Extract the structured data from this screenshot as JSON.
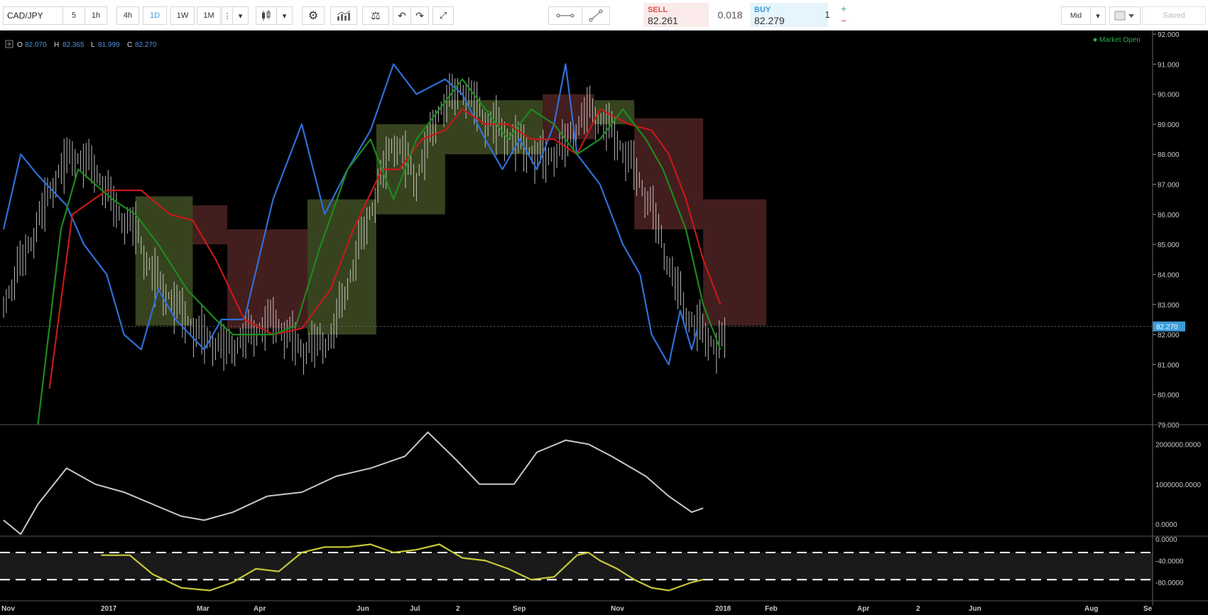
{
  "toolbar": {
    "symbol": "CAD/JPY",
    "timeframes": [
      "5",
      "1h",
      "4h",
      "1D",
      "1W",
      "1M"
    ],
    "active_timeframe": "1D",
    "sell_label": "SELL",
    "sell_price": "82.261",
    "spread": "0.018",
    "buy_label": "BUY",
    "buy_price": "82.279",
    "quantity": "1",
    "plus": "+",
    "minus": "−",
    "price_mode": "Mid",
    "saved_label": "Saved",
    "icons": [
      "more-icon",
      "dropdown-icon",
      "candlestick-icon",
      "settings-icon",
      "indicators-icon",
      "balance-icon",
      "undo-icon",
      "redo-icon",
      "fullscreen-icon",
      "horizontal-line-icon",
      "trend-line-icon",
      "color-swatch-icon"
    ]
  },
  "ohlc": {
    "open_label": "O",
    "open": "82.070",
    "high_label": "H",
    "high": "82.365",
    "low_label": "L",
    "low": "81.999",
    "close_label": "C",
    "close": "82.270"
  },
  "market_status": "Market Open",
  "colors": {
    "background": "#000000",
    "price_bars": "#d9d9d9",
    "blue_line": "#2f6fd6",
    "red_line": "#c81818",
    "green_line": "#1d8a1d",
    "cloud_bull": "#4a5a2a",
    "cloud_bear": "#5a2828",
    "volume_line": "#c8c8c8",
    "oscillator_line": "#c8c83a",
    "price_tag": "#3a9ad9"
  },
  "chart_data": [
    {
      "type": "line",
      "symbol": "CAD/JPY",
      "ylim": [
        79.0,
        92.0
      ],
      "y_ticks": [
        "92.000",
        "91.000",
        "90.000",
        "89.000",
        "88.000",
        "87.000",
        "86.000",
        "85.000",
        "84.000",
        "83.000",
        "82.000",
        "81.000",
        "80.000",
        "79.000"
      ],
      "current_price": "82.270",
      "x_ticks": [
        "Nov",
        "2017",
        "Mar",
        "Apr",
        "Jun",
        "Jul",
        "2",
        "Sep",
        "Nov",
        "2018",
        "Feb",
        "Apr",
        "2",
        "Jun",
        "Aug",
        "Se"
      ],
      "price_approx": [
        [
          0,
          83
        ],
        [
          25,
          85.2
        ],
        [
          45,
          87.2
        ],
        [
          60,
          88.0
        ],
        [
          80,
          87.5
        ],
        [
          100,
          86.0
        ],
        [
          115,
          85.5
        ],
        [
          130,
          84.0
        ],
        [
          150,
          83.0
        ],
        [
          170,
          82.0
        ],
        [
          195,
          81.5
        ],
        [
          215,
          82.0
        ],
        [
          235,
          82.5
        ],
        [
          260,
          81.5
        ],
        [
          285,
          81.8
        ],
        [
          315,
          85.5
        ],
        [
          340,
          88.5
        ],
        [
          360,
          87.2
        ],
        [
          380,
          89.5
        ],
        [
          400,
          90.2
        ],
        [
          420,
          89.2
        ],
        [
          445,
          88.5
        ],
        [
          470,
          87.8
        ],
        [
          490,
          88.3
        ],
        [
          510,
          89.5
        ],
        [
          530,
          88.8
        ],
        [
          550,
          87.5
        ],
        [
          565,
          86.2
        ],
        [
          580,
          84.3
        ],
        [
          595,
          82.7
        ],
        [
          610,
          82.0
        ],
        [
          622,
          81.6
        ],
        [
          630,
          81.9
        ]
      ],
      "series": [
        {
          "name": "",
          "role": "lagging span (blue)",
          "points": [
            [
              0,
              85.5
            ],
            [
              15,
              88.0
            ],
            [
              30,
              87.3
            ],
            [
              55,
              86.3
            ],
            [
              70,
              85.0
            ],
            [
              90,
              84.0
            ],
            [
              105,
              82.0
            ],
            [
              120,
              81.5
            ],
            [
              135,
              83.5
            ],
            [
              150,
              82.5
            ],
            [
              175,
              81.5
            ],
            [
              190,
              82.5
            ],
            [
              210,
              82.5
            ],
            [
              235,
              86.5
            ],
            [
              260,
              89.0
            ],
            [
              280,
              86.0
            ],
            [
              300,
              87.5
            ],
            [
              320,
              88.8
            ],
            [
              340,
              91.0
            ],
            [
              360,
              90.0
            ],
            [
              385,
              90.5
            ],
            [
              400,
              90.0
            ],
            [
              420,
              88.5
            ],
            [
              435,
              87.5
            ],
            [
              450,
              88.5
            ],
            [
              465,
              87.5
            ],
            [
              480,
              89.0
            ],
            [
              490,
              91.0
            ],
            [
              500,
              88.0
            ],
            [
              520,
              87.0
            ],
            [
              540,
              85.0
            ],
            [
              555,
              84.0
            ],
            [
              565,
              82.0
            ],
            [
              580,
              81.0
            ],
            [
              590,
              82.8
            ],
            [
              600,
              81.5
            ],
            [
              605,
              82.2
            ]
          ]
        },
        {
          "name": "",
          "role": "base line (red)",
          "points": [
            [
              40,
              80.2
            ],
            [
              60,
              86.0
            ],
            [
              90,
              86.8
            ],
            [
              120,
              86.8
            ],
            [
              145,
              86.0
            ],
            [
              165,
              85.8
            ],
            [
              185,
              84.5
            ],
            [
              210,
              82.5
            ],
            [
              235,
              82.0
            ],
            [
              260,
              82.2
            ],
            [
              285,
              83.5
            ],
            [
              305,
              85.5
            ],
            [
              330,
              87.5
            ],
            [
              345,
              87.5
            ],
            [
              365,
              88.5
            ],
            [
              385,
              88.8
            ],
            [
              400,
              89.5
            ],
            [
              420,
              89.0
            ],
            [
              440,
              89.0
            ],
            [
              460,
              88.5
            ],
            [
              480,
              88.5
            ],
            [
              500,
              88.0
            ],
            [
              520,
              89.5
            ],
            [
              545,
              89.0
            ],
            [
              565,
              88.8
            ],
            [
              580,
              88.0
            ],
            [
              595,
              86.5
            ],
            [
              610,
              84.5
            ],
            [
              625,
              83.0
            ]
          ]
        },
        {
          "name": "",
          "role": "conversion line (green)",
          "points": [
            [
              30,
              79.0
            ],
            [
              50,
              85.5
            ],
            [
              65,
              87.5
            ],
            [
              80,
              87.0
            ],
            [
              95,
              86.5
            ],
            [
              115,
              86.0
            ],
            [
              135,
              85.0
            ],
            [
              160,
              83.5
            ],
            [
              185,
              82.5
            ],
            [
              200,
              82.0
            ],
            [
              215,
              82.0
            ],
            [
              235,
              82.0
            ],
            [
              255,
              82.3
            ],
            [
              275,
              84.8
            ],
            [
              300,
              87.5
            ],
            [
              320,
              88.5
            ],
            [
              340,
              86.5
            ],
            [
              360,
              88.5
            ],
            [
              380,
              89.5
            ],
            [
              400,
              90.5
            ],
            [
              420,
              89.5
            ],
            [
              440,
              88.5
            ],
            [
              460,
              89.5
            ],
            [
              480,
              89.0
            ],
            [
              500,
              88.0
            ],
            [
              520,
              88.5
            ],
            [
              540,
              89.5
            ],
            [
              560,
              88.5
            ],
            [
              575,
              87.5
            ],
            [
              595,
              85.5
            ],
            [
              610,
              83.0
            ],
            [
              625,
              81.5
            ]
          ]
        }
      ],
      "cloud": [
        {
          "from": 115,
          "to": 165,
          "top": 86.6,
          "bottom": 82.3,
          "tone": "bull"
        },
        {
          "from": 165,
          "to": 195,
          "top": 86.3,
          "bottom": 85.0,
          "tone": "bear"
        },
        {
          "from": 195,
          "to": 265,
          "top": 85.5,
          "bottom": 82.2,
          "tone": "bear"
        },
        {
          "from": 265,
          "to": 325,
          "top": 86.5,
          "bottom": 82.0,
          "tone": "bull"
        },
        {
          "from": 325,
          "to": 385,
          "top": 89.0,
          "bottom": 86.0,
          "tone": "bull"
        },
        {
          "from": 385,
          "to": 470,
          "top": 89.8,
          "bottom": 88.0,
          "tone": "bull"
        },
        {
          "from": 470,
          "to": 515,
          "top": 90.0,
          "bottom": 88.5,
          "tone": "bear"
        },
        {
          "from": 515,
          "to": 550,
          "top": 89.8,
          "bottom": 89.0,
          "tone": "bull"
        },
        {
          "from": 550,
          "to": 610,
          "top": 89.2,
          "bottom": 85.5,
          "tone": "bear"
        },
        {
          "from": 610,
          "to": 665,
          "top": 86.5,
          "bottom": 82.3,
          "tone": "bear"
        }
      ]
    },
    {
      "type": "line",
      "panel": "volume-style indicator",
      "ylim": [
        -300000,
        2400000
      ],
      "y_ticks": [
        "2000000.0000",
        "1000000.0000",
        "0.0000"
      ],
      "points": [
        [
          0,
          100000
        ],
        [
          15,
          -250000
        ],
        [
          30,
          500000
        ],
        [
          55,
          1400000
        ],
        [
          80,
          1000000
        ],
        [
          105,
          800000
        ],
        [
          130,
          500000
        ],
        [
          155,
          200000
        ],
        [
          175,
          100000
        ],
        [
          200,
          300000
        ],
        [
          230,
          700000
        ],
        [
          260,
          800000
        ],
        [
          290,
          1200000
        ],
        [
          320,
          1400000
        ],
        [
          350,
          1700000
        ],
        [
          370,
          2300000
        ],
        [
          395,
          1600000
        ],
        [
          415,
          1000000
        ],
        [
          445,
          1000000
        ],
        [
          465,
          1800000
        ],
        [
          490,
          2100000
        ],
        [
          510,
          2000000
        ],
        [
          530,
          1700000
        ],
        [
          560,
          1200000
        ],
        [
          580,
          700000
        ],
        [
          600,
          300000
        ],
        [
          610,
          400000
        ]
      ]
    },
    {
      "type": "line",
      "panel": "oscillator",
      "ylim": [
        -110,
        5
      ],
      "y_ticks": [
        "0.0000",
        "-40.0000",
        "-80.0000"
      ],
      "bands": [
        -25,
        -75
      ],
      "points": [
        [
          85,
          -30
        ],
        [
          110,
          -30
        ],
        [
          130,
          -65
        ],
        [
          155,
          -90
        ],
        [
          180,
          -95
        ],
        [
          200,
          -80
        ],
        [
          220,
          -55
        ],
        [
          240,
          -60
        ],
        [
          260,
          -25
        ],
        [
          280,
          -15
        ],
        [
          300,
          -15
        ],
        [
          320,
          -10
        ],
        [
          340,
          -25
        ],
        [
          360,
          -20
        ],
        [
          380,
          -10
        ],
        [
          400,
          -35
        ],
        [
          420,
          -40
        ],
        [
          440,
          -55
        ],
        [
          460,
          -75
        ],
        [
          480,
          -70
        ],
        [
          500,
          -30
        ],
        [
          510,
          -25
        ],
        [
          520,
          -40
        ],
        [
          535,
          -55
        ],
        [
          550,
          -75
        ],
        [
          565,
          -90
        ],
        [
          580,
          -95
        ],
        [
          600,
          -80
        ],
        [
          610,
          -75
        ]
      ]
    }
  ]
}
